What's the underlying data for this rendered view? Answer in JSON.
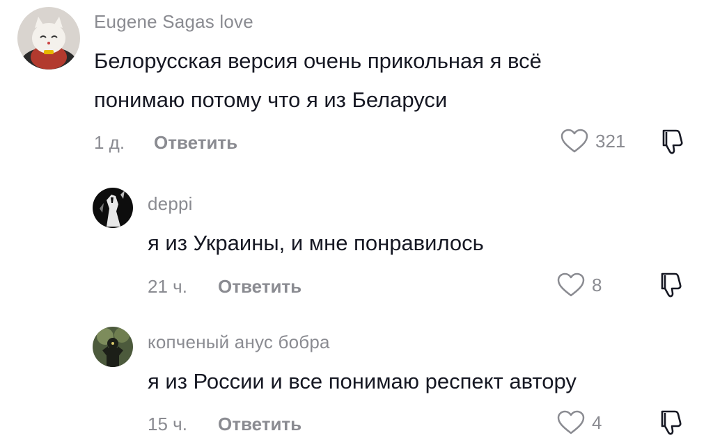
{
  "comments": [
    {
      "username": "Eugene  Sagas love",
      "text_lines": [
        "Белорусская версия очень прикольная я всё",
        "понимаю потому что я из Беларуси"
      ],
      "time": "1 д.",
      "reply_label": "Ответить",
      "likes": "321",
      "avatar_icon": "lucky-cat-avatar"
    },
    {
      "username": "deppi",
      "text_lines": [
        "я из Украины, и мне понравилось"
      ],
      "time": "21 ч.",
      "reply_label": "Ответить",
      "likes": "8",
      "avatar_icon": "dark-figure-avatar"
    },
    {
      "username": "копченый анус бобра",
      "text_lines": [
        "я из России и все понимаю респект автору"
      ],
      "time": "15 ч.",
      "reply_label": "Ответить",
      "likes": "4",
      "avatar_icon": "forest-figure-avatar"
    }
  ],
  "icons": {
    "like": "heart-outline-icon",
    "dislike": "thumbs-down-outline-icon"
  },
  "colors": {
    "text": "#161823",
    "secondary": "#8a8b91",
    "background": "#ffffff"
  }
}
